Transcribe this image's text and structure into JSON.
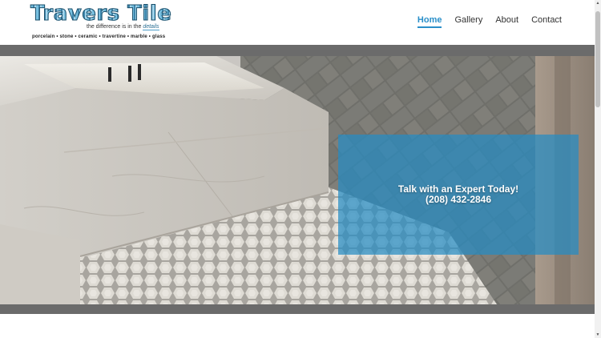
{
  "logo": {
    "title": "Travers Tile",
    "tagline_prefix": "the difference is in the ",
    "tagline_emphasis": "details",
    "materials": "porcelain  •  stone  •  ceramic  •  travertine  •  marble  •  glass"
  },
  "nav": {
    "items": [
      {
        "label": "Home",
        "active": true
      },
      {
        "label": "Gallery",
        "active": false
      },
      {
        "label": "About",
        "active": false
      },
      {
        "label": "Contact",
        "active": false
      }
    ]
  },
  "hero": {
    "cta_line1": "Talk with an Expert Today!",
    "cta_line2": "(208) 432-2846"
  },
  "colors": {
    "accent": "#2a8fc9",
    "panel": "#268cc4",
    "band": "#6b6b6b"
  }
}
